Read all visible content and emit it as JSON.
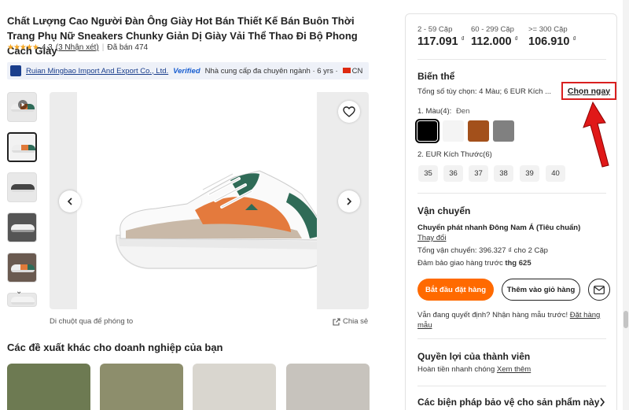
{
  "product": {
    "title": "Chất Lượng Cao Người Đàn Ông Giày Hot Bán Thiết Kế Bán Buôn Thời Trang Phụ Nữ Sneakers Chunky Giản Dị Giày Vải Thể Thao Đi Bộ Phong Cách Giày",
    "rating": "4.3",
    "stars": "★★★★★",
    "reviews_link": "(3 Nhận xét)",
    "sold": "Đã bán 474"
  },
  "supplier": {
    "name": "Ruian Mingbao Import And Export Co., Ltd.",
    "verified": "Verified",
    "desc": "Nhà cung cấp đa chuyên ngành · 6 yrs ·",
    "country": "CN"
  },
  "gallery": {
    "hover_hint": "Di chuột qua để phóng to",
    "share": "Chia sẻ",
    "down_arrow": "⌄"
  },
  "recommend_title": "Các đề xuất khác cho doanh nghiệp của bạn",
  "pricing": [
    {
      "tier": "2 - 59 Cặp",
      "price": "117.091",
      "currency": "₫"
    },
    {
      "tier": "60 - 299 Cặp",
      "price": "112.000",
      "currency": "₫"
    },
    {
      "tier": ">= 300 Cặp",
      "price": "106.910",
      "currency": "₫"
    }
  ],
  "variants": {
    "title": "Biến thể",
    "summary": "Tổng số tùy chọn: 4 Màu; 6 EUR Kích ...",
    "choose": "Chọn ngay",
    "color_label": "1. Màu(4):",
    "color_selected": "Đen",
    "colors": [
      "#000000",
      "#f4f4f4",
      "#a3501b",
      "#808080"
    ],
    "size_label": "2. EUR Kích Thước(6)",
    "sizes": [
      "35",
      "36",
      "37",
      "38",
      "39",
      "40"
    ]
  },
  "shipping": {
    "title": "Vận chuyển",
    "method": "Chuyển phát nhanh Đông Nam Á (Tiêu chuẩn)",
    "change": "Thay đổi",
    "cost": "Tổng vận chuyển: 396.327 ₫ cho 2 Cặp",
    "delivery_prefix": "Đảm bảo giao hàng trước",
    "delivery_date": "thg 625"
  },
  "actions": {
    "order": "Bắt đầu đặt hàng",
    "cart": "Thêm vào giỏ hàng",
    "sample_prefix": "Vẫn đang quyết định? Nhận hàng mẫu trước!",
    "sample_link": "Đặt hàng mẫu"
  },
  "benefits": {
    "title": "Quyền lợi của thành viên",
    "refund": "Hoàn tiền nhanh chóng",
    "see_more": "Xem thêm"
  },
  "protection": {
    "title": "Các biện pháp bảo vệ cho sản phẩm này"
  },
  "colors": {
    "accent": "#ff6a00",
    "highlight": "#d92020",
    "brand_blue": "#1a3e8c"
  }
}
